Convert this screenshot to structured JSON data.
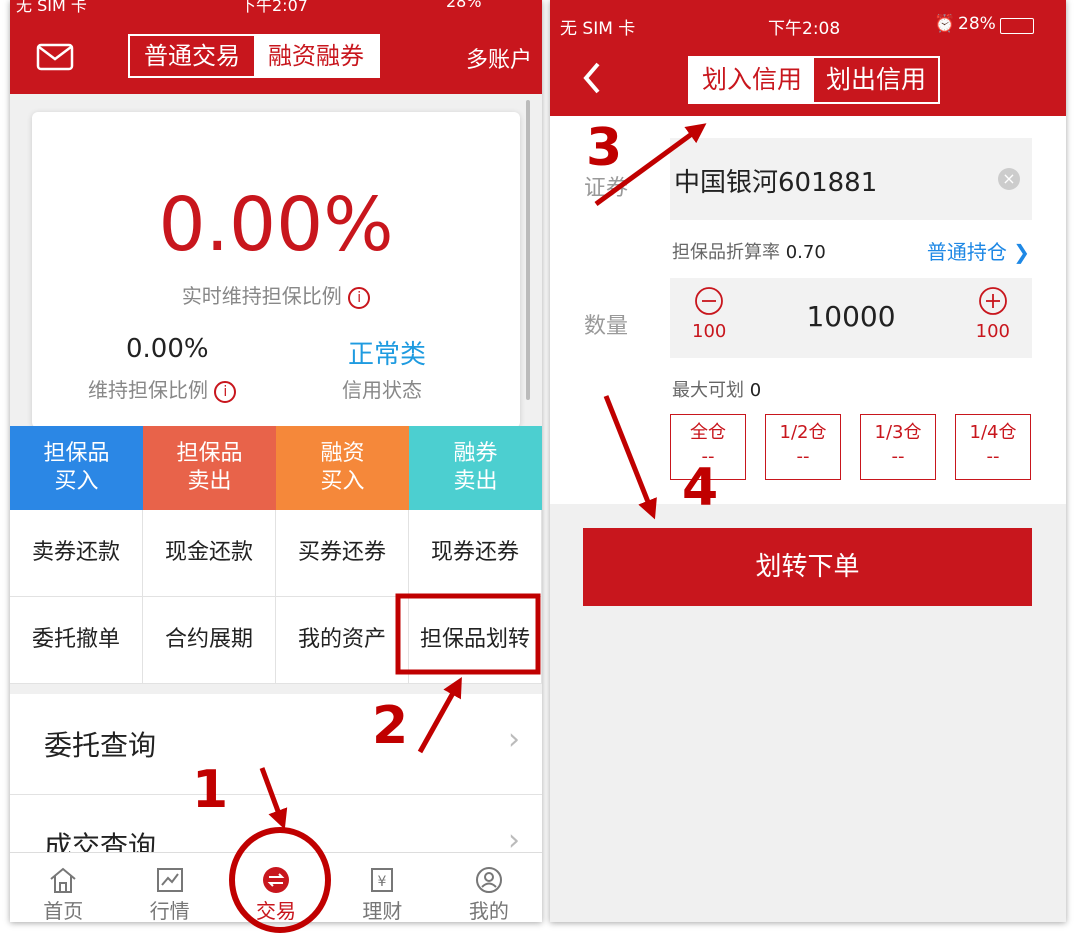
{
  "left": {
    "status": {
      "carrier": "无 SIM 卡",
      "time": "下午2:07",
      "battery": "28%"
    },
    "nav": {
      "tabs": [
        "普通交易",
        "融资融券"
      ],
      "active_tab": 1,
      "multi_account": "多账户"
    },
    "card": {
      "big_ratio": "0.00%",
      "big_ratio_label": "实时维持担保比例",
      "maintain_ratio": "0.00%",
      "maintain_label": "维持担保比例",
      "credit_status": "正常类",
      "credit_label": "信用状态"
    },
    "colored_buttons": [
      {
        "line1": "担保品",
        "line2": "买入",
        "color": "#2b87e5"
      },
      {
        "line1": "担保品",
        "line2": "卖出",
        "color": "#e8634a"
      },
      {
        "line1": "融资",
        "line2": "买入",
        "color": "#f5883a"
      },
      {
        "line1": "融券",
        "line2": "卖出",
        "color": "#4ccfd0"
      }
    ],
    "grid_buttons": [
      "卖券还款",
      "现金还款",
      "买券还券",
      "现券还券",
      "委托撤单",
      "合约展期",
      "我的资产",
      "担保品划转"
    ],
    "menu": [
      "委托查询",
      "成交查询"
    ],
    "tabbar": [
      "首页",
      "行情",
      "交易",
      "理财",
      "我的"
    ],
    "active_tab_index": 2
  },
  "right": {
    "status": {
      "carrier": "无 SIM 卡",
      "time": "下午2:08",
      "battery": "28%"
    },
    "nav": {
      "tabs": [
        "划入信用",
        "划出信用"
      ],
      "active_tab": 0
    },
    "security_label": "证券",
    "security_value": "中国银河601881",
    "rate_label": "担保品折算率",
    "rate_value": "0.70",
    "normal_position": "普通持仓",
    "qty_label": "数量",
    "qty_value": "10000",
    "step_minus": "100",
    "step_plus": "100",
    "max_label": "最大可划",
    "max_value": "0",
    "portions": [
      {
        "label": "全仓",
        "value": "--"
      },
      {
        "label": "1/2仓",
        "value": "--"
      },
      {
        "label": "1/3仓",
        "value": "--"
      },
      {
        "label": "1/4仓",
        "value": "--"
      }
    ],
    "submit": "划转下单"
  },
  "annotations": [
    "1",
    "2",
    "3",
    "4"
  ],
  "colors": {
    "brand_red": "#c8161d",
    "annotation_red": "#c00000",
    "link_blue": "#1e88e5"
  }
}
